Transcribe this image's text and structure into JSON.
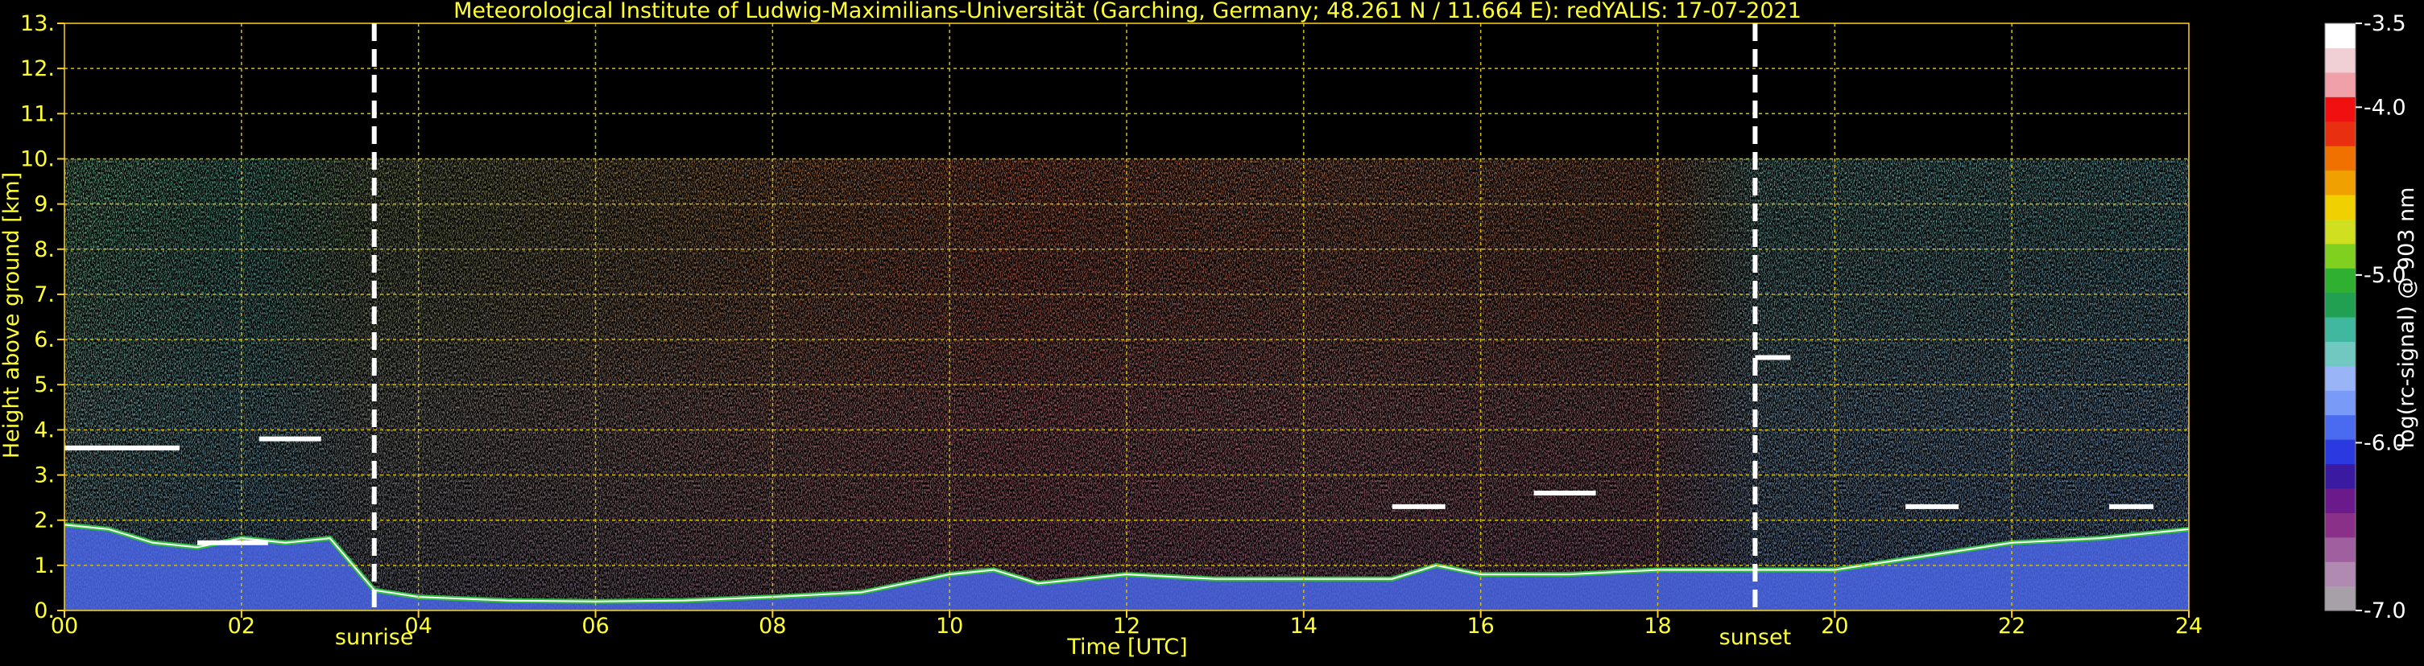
{
  "chart_data": {
    "type": "heatmap",
    "title": "Meteorological Institute of Ludwig-Maximilians-Universität (Garching, Germany; 48.261 N / 11.664 E):    redYALIS: 17-07-2021",
    "xlabel": "Time [UTC]",
    "ylabel": "Height above ground [km]",
    "xlim": [
      0,
      24
    ],
    "ylim": [
      0,
      13
    ],
    "x_ticks": [
      "00",
      "02",
      "04",
      "06",
      "08",
      "10",
      "12",
      "14",
      "16",
      "18",
      "20",
      "22",
      "24"
    ],
    "y_ticks": [
      "0.",
      "1.",
      "2.",
      "3.",
      "4.",
      "5.",
      "6.",
      "7.",
      "8.",
      "9.",
      "10.",
      "11.",
      "12.",
      "13."
    ],
    "grid": true,
    "data_top_km": 10,
    "annotations": [
      {
        "label": "sunrise",
        "time": 3.5
      },
      {
        "label": "sunset",
        "time": 19.1
      }
    ],
    "colorbar": {
      "label": "log(rc-signal) @ 903 nm",
      "range": [
        -7.0,
        -3.5
      ],
      "tick_values": [
        -3.5,
        -4.0,
        -5.0,
        -6.0,
        -7.0
      ],
      "tick_labels": [
        "-3.5",
        "-4.0",
        "-5.0",
        "-6.0",
        "-7.0"
      ],
      "colors": [
        "#a8a0a8",
        "#b08ab0",
        "#a060a0",
        "#8a3088",
        "#6a1a8a",
        "#3a1aa0",
        "#2a3ae0",
        "#4a6af0",
        "#7a9af8",
        "#9ab4f8",
        "#70c8c0",
        "#40b8a0",
        "#20a050",
        "#30b030",
        "#80d020",
        "#d0e020",
        "#f0d000",
        "#f0a000",
        "#f07000",
        "#e83010",
        "#f01010",
        "#f0a0a8",
        "#f0d0d4",
        "#ffffff"
      ]
    },
    "series": [
      {
        "name": "boundary layer top (approx.)",
        "times": [
          0,
          0.5,
          1,
          1.5,
          2,
          2.5,
          3,
          3.5,
          4,
          5,
          6,
          7,
          8,
          9,
          10,
          10.5,
          11,
          11.5,
          12,
          13,
          14,
          15,
          15.5,
          16,
          17,
          18,
          19,
          19.5,
          20,
          21,
          22,
          23,
          24
        ],
        "heights": [
          1.9,
          1.8,
          1.5,
          1.4,
          1.6,
          1.5,
          1.6,
          0.45,
          0.3,
          0.22,
          0.2,
          0.22,
          0.3,
          0.4,
          0.8,
          0.9,
          0.6,
          0.7,
          0.8,
          0.7,
          0.7,
          0.7,
          1.0,
          0.8,
          0.8,
          0.9,
          0.9,
          0.9,
          0.9,
          1.2,
          1.5,
          1.6,
          1.8
        ]
      },
      {
        "name": "cloud layers (approx.)",
        "segments": [
          {
            "t0": 0.0,
            "t1": 1.3,
            "h": 3.6
          },
          {
            "t0": 2.2,
            "t1": 2.9,
            "h": 3.8
          },
          {
            "t0": 1.5,
            "t1": 2.3,
            "h": 1.5
          },
          {
            "t0": 19.1,
            "t1": 19.5,
            "h": 5.6
          },
          {
            "t0": 15.0,
            "t1": 15.6,
            "h": 2.3
          },
          {
            "t0": 16.6,
            "t1": 17.3,
            "h": 2.6
          },
          {
            "t0": 20.8,
            "t1": 21.4,
            "h": 2.3
          },
          {
            "t0": 23.1,
            "t1": 23.6,
            "h": 2.3
          }
        ]
      }
    ]
  }
}
